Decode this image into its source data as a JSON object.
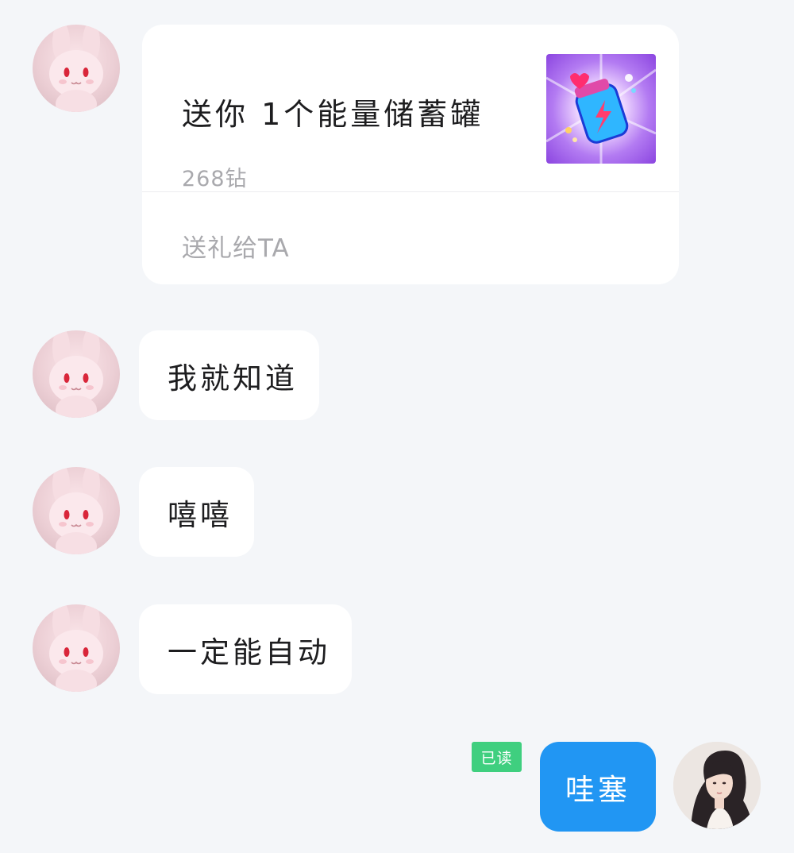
{
  "gift_message": {
    "title": "送你 1个能量储蓄罐",
    "price": "268钻",
    "action": "送礼给TA",
    "gift_icon": "energy-jar-icon"
  },
  "messages": [
    {
      "text": "我就知道",
      "direction": "incoming"
    },
    {
      "text": "嘻嘻",
      "direction": "incoming"
    },
    {
      "text": "一定能自动",
      "direction": "incoming"
    },
    {
      "text": "哇塞",
      "direction": "outgoing",
      "status": "已读"
    }
  ],
  "colors": {
    "background": "#f4f6f9",
    "incoming_bubble": "#ffffff",
    "outgoing_bubble": "#2196f3",
    "read_badge": "#3fcf7f",
    "secondary_text": "#a9a9ad"
  },
  "avatars": {
    "contact": "pink-bunny-plush-avatar",
    "self": "woman-portrait-avatar"
  }
}
